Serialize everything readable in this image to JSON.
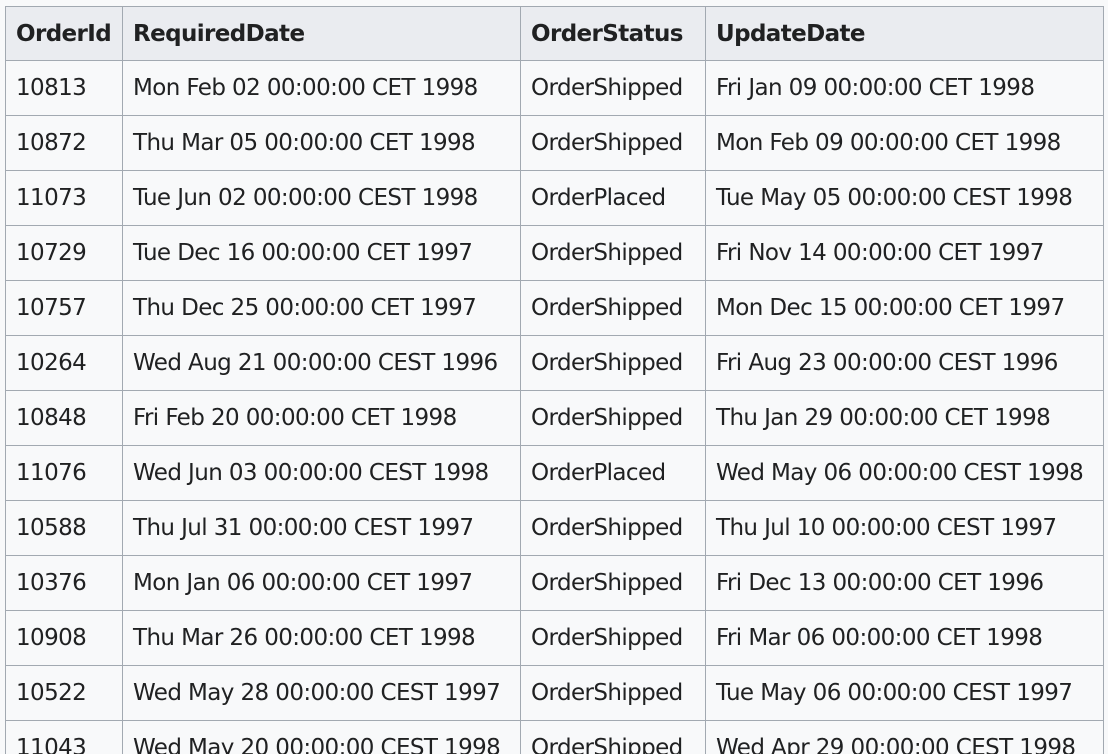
{
  "table": {
    "columns": [
      "OrderId",
      "RequiredDate",
      "OrderStatus",
      "UpdateDate"
    ],
    "rows": [
      [
        "10813",
        "Mon Feb 02 00:00:00 CET 1998",
        "OrderShipped",
        "Fri Jan 09 00:00:00 CET 1998"
      ],
      [
        "10872",
        "Thu Mar 05 00:00:00 CET 1998",
        "OrderShipped",
        "Mon Feb 09 00:00:00 CET 1998"
      ],
      [
        "11073",
        "Tue Jun 02 00:00:00 CEST 1998",
        "OrderPlaced",
        "Tue May 05 00:00:00 CEST 1998"
      ],
      [
        "10729",
        "Tue Dec 16 00:00:00 CET 1997",
        "OrderShipped",
        "Fri Nov 14 00:00:00 CET 1997"
      ],
      [
        "10757",
        "Thu Dec 25 00:00:00 CET 1997",
        "OrderShipped",
        "Mon Dec 15 00:00:00 CET 1997"
      ],
      [
        "10264",
        "Wed Aug 21 00:00:00 CEST 1996",
        "OrderShipped",
        "Fri Aug 23 00:00:00 CEST 1996"
      ],
      [
        "10848",
        "Fri Feb 20 00:00:00 CET 1998",
        "OrderShipped",
        "Thu Jan 29 00:00:00 CET 1998"
      ],
      [
        "11076",
        "Wed Jun 03 00:00:00 CEST 1998",
        "OrderPlaced",
        "Wed May 06 00:00:00 CEST 1998"
      ],
      [
        "10588",
        "Thu Jul 31 00:00:00 CEST 1997",
        "OrderShipped",
        "Thu Jul 10 00:00:00 CEST 1997"
      ],
      [
        "10376",
        "Mon Jan 06 00:00:00 CET 1997",
        "OrderShipped",
        "Fri Dec 13 00:00:00 CET 1996"
      ],
      [
        "10908",
        "Thu Mar 26 00:00:00 CET 1998",
        "OrderShipped",
        "Fri Mar 06 00:00:00 CET 1998"
      ],
      [
        "10522",
        "Wed May 28 00:00:00 CEST 1997",
        "OrderShipped",
        "Tue May 06 00:00:00 CEST 1997"
      ],
      [
        "11043",
        "Wed May 20 00:00:00 CEST 1998",
        "OrderShipped",
        "Wed Apr 29 00:00:00 CEST 1998"
      ]
    ]
  }
}
